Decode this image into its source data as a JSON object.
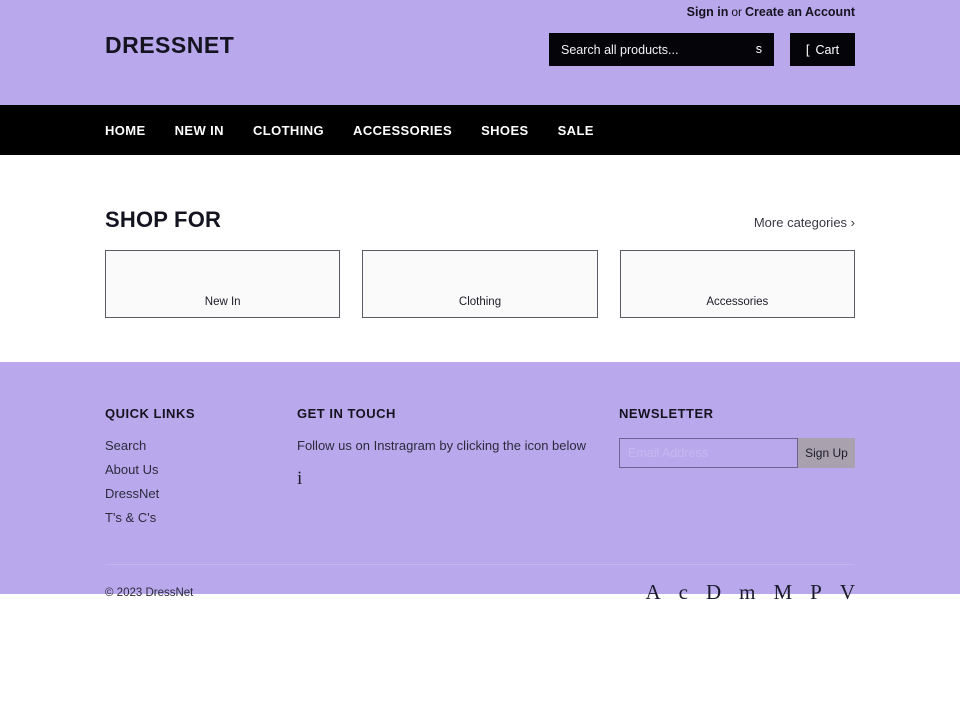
{
  "theme": {
    "accent_purple": "#b9a9ec",
    "nav_black": "#000000",
    "card_fill": "#fafafa",
    "signup_button": "#a9a1ad"
  },
  "header": {
    "brand": "DRESSNET",
    "account": {
      "sign_in": "Sign in",
      "separator": "or",
      "create_account": "Create an Account"
    },
    "search": {
      "placeholder": "Search all products...",
      "value": "",
      "submit_icon": "s"
    },
    "cart": {
      "icon": "[",
      "label": "Cart"
    }
  },
  "nav": {
    "items": [
      {
        "label": "HOME"
      },
      {
        "label": "NEW IN"
      },
      {
        "label": "CLOTHING"
      },
      {
        "label": "ACCESSORIES"
      },
      {
        "label": "SHOES"
      },
      {
        "label": "SALE"
      }
    ]
  },
  "main": {
    "section_title": "SHOP FOR",
    "more_link": "More categories ›",
    "cards": [
      {
        "label": "New In"
      },
      {
        "label": "Clothing"
      },
      {
        "label": "Accessories"
      }
    ]
  },
  "footer": {
    "quick_links": {
      "title": "QUICK LINKS",
      "items": [
        {
          "label": "Search"
        },
        {
          "label": "About Us"
        },
        {
          "label": "DressNet"
        },
        {
          "label": "T's & C's"
        }
      ]
    },
    "get_in_touch": {
      "title": "GET IN TOUCH",
      "text": "Follow us on Instragram by clicking the icon below",
      "social_icon": "i"
    },
    "newsletter": {
      "title": "NEWSLETTER",
      "placeholder": "Email Address",
      "value": "",
      "submit_label": "Sign Up"
    },
    "bottom": {
      "copyright": "© 2023 DressNet",
      "payment_icons": [
        {
          "glyph": "A"
        },
        {
          "glyph": "c"
        },
        {
          "glyph": "D"
        },
        {
          "glyph": "m"
        },
        {
          "glyph": "M"
        },
        {
          "glyph": "P"
        },
        {
          "glyph": "V"
        }
      ]
    }
  }
}
